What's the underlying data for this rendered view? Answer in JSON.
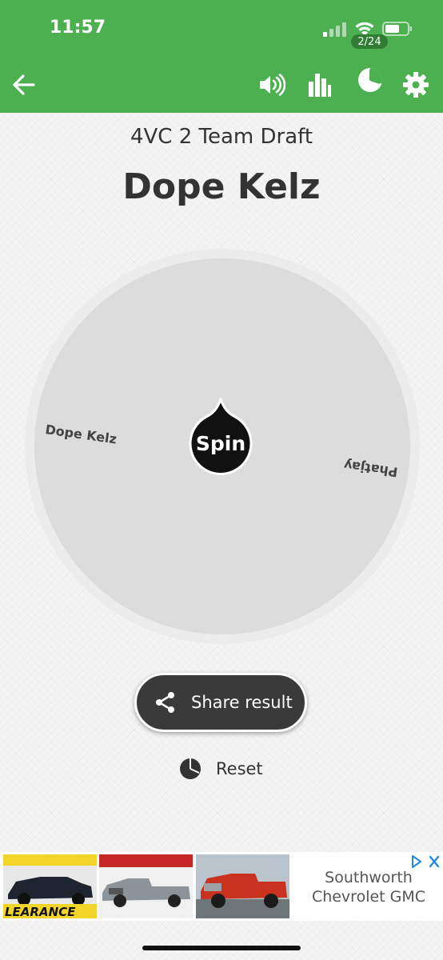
{
  "status_bar": {
    "time": "11:57"
  },
  "toolbar": {
    "wheel_count": "2/24",
    "icons": [
      "arrow-left-icon",
      "volume-icon",
      "bar-chart-icon",
      "pie-chart-icon",
      "gear-icon"
    ]
  },
  "wheel": {
    "title": "4VC 2 Team Draft",
    "result": "Dope Kelz",
    "entries": [
      "Dope Kelz",
      "Phatjay"
    ],
    "spin_label": "Spin"
  },
  "actions": {
    "share_label": "Share result",
    "reset_label": "Reset"
  },
  "ad": {
    "text_line1": "Southworth",
    "text_line2": "Chevrolet GMC",
    "image_text": "LEARANCE"
  },
  "colors": {
    "header": "#4caf50",
    "badge": "#2e7d32",
    "button_dark": "#3a3a3a"
  }
}
